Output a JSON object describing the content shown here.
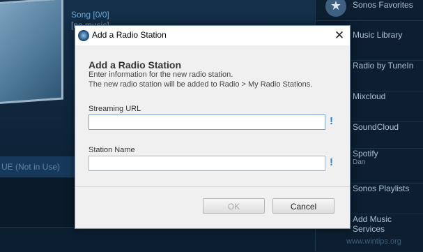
{
  "background": {
    "song_title": "Song [0/0]",
    "song_subtitle": "[no music]",
    "queue_label": "UE (Not in Use)",
    "watermark": "www.wintips.org"
  },
  "sidebar": {
    "items": [
      {
        "label": "Sonos Favorites",
        "icon": "star-icon"
      },
      {
        "label": "Music Library",
        "icon": "music-library-icon"
      },
      {
        "label": "Radio by TuneIn",
        "icon": "tunein-icon"
      },
      {
        "label": "Mixcloud",
        "icon": "mixcloud-icon"
      },
      {
        "label": "SoundCloud",
        "icon": "soundcloud-icon"
      },
      {
        "label": "Spotify",
        "sublabel": "Dan",
        "icon": "spotify-icon"
      },
      {
        "label": "Sonos Playlists",
        "icon": "playlists-icon"
      },
      {
        "label": "Add Music Services",
        "icon": "add-services-icon"
      }
    ]
  },
  "dialog": {
    "window_title": "Add a Radio Station",
    "close_glyph": "✕",
    "heading": "Add a Radio Station",
    "description_line1": "Enter information for the new radio station.",
    "description_line2": "The new radio station will be added to Radio > My Radio Stations.",
    "url_label": "Streaming URL",
    "url_value": "",
    "name_label": "Station Name",
    "name_value": "",
    "required_glyph": "!",
    "ok_label": "OK",
    "cancel_label": "Cancel",
    "ok_enabled": false
  },
  "colors": {
    "accent": "#1e82d8",
    "app_background": "#0e2236",
    "dialog_background": "#f0f0f0"
  }
}
